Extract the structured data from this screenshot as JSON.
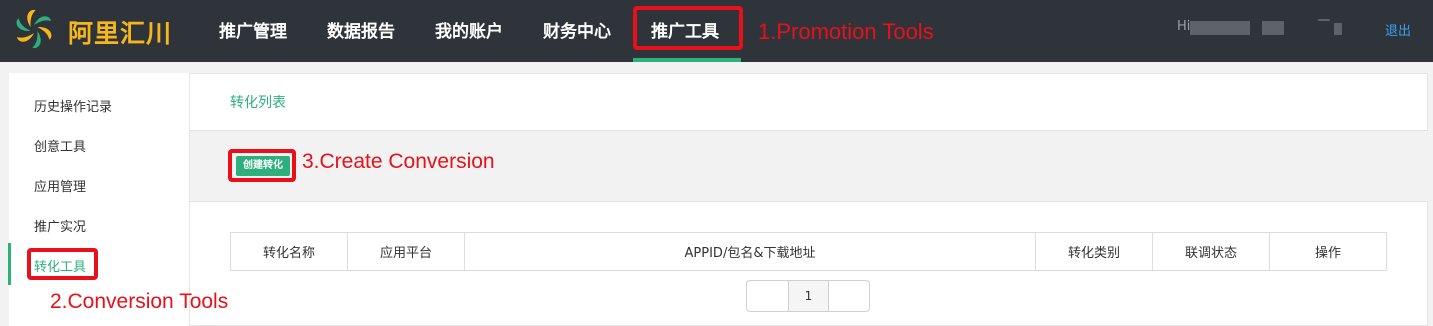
{
  "header": {
    "brand": "阿里汇川",
    "nav": [
      "推广管理",
      "数据报告",
      "我的账户",
      "财务中心",
      "推广工具"
    ],
    "user_greeting": "Hi",
    "logout": "退出"
  },
  "sidebar": {
    "items": [
      "历史操作记录",
      "创意工具",
      "应用管理",
      "推广实况",
      "转化工具"
    ]
  },
  "main": {
    "breadcrumb": "转化列表",
    "create_button": "创建转化",
    "table_headers": [
      "转化名称",
      "应用平台",
      "APPID/包名&下载地址",
      "转化类别",
      "联调状态",
      "操作"
    ],
    "pager_current": "1"
  },
  "annotations": {
    "a1": "1.Promotion Tools",
    "a2": "2.Conversion Tools",
    "a3": "3.Create Conversion"
  },
  "colors": {
    "topbar": "#2f343b",
    "brand": "#f5b71c",
    "accent_green": "#2db07d",
    "annotation_red": "#e8101a",
    "logout_link": "#3aa0f0"
  },
  "icons": {
    "logo": "pinwheel-logo-icon"
  }
}
